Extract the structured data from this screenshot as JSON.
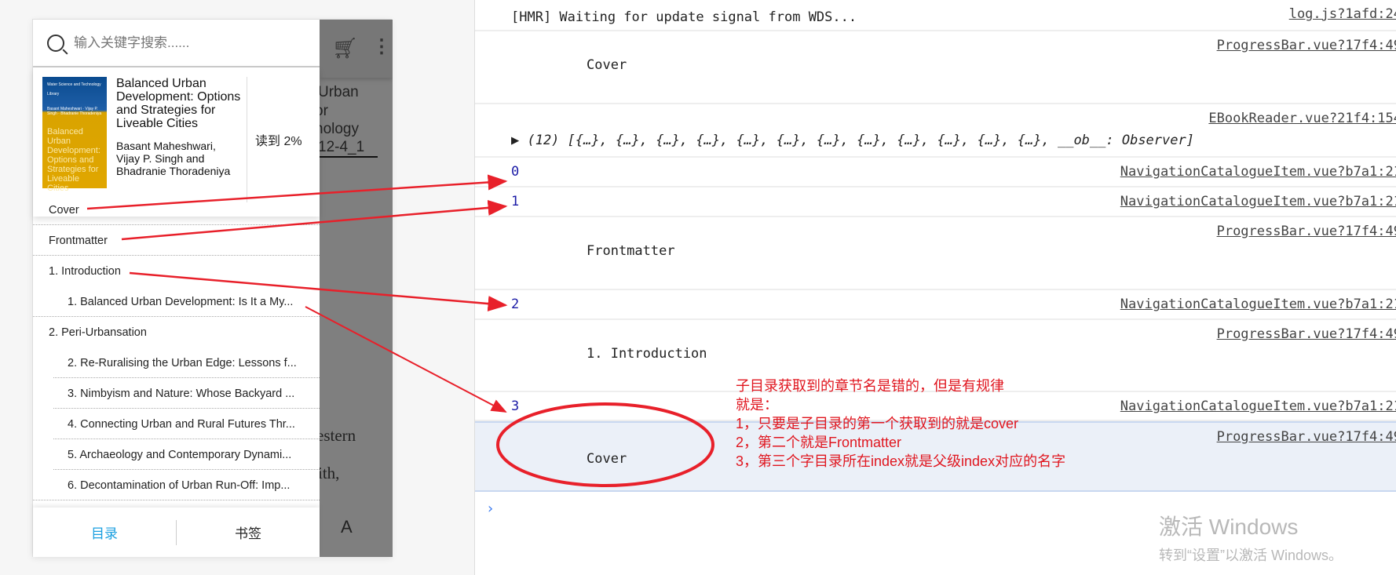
{
  "search": {
    "placeholder": "输入关键字搜索......"
  },
  "book": {
    "cover_series": "Water Science and Technology Library",
    "cover_authors": "Basant Maheshwari · Vijay P. Singh · Bhadranie Thoradeniya",
    "cover_title": "Balanced Urban Development: Options and Strategies for Liveable Cities",
    "title": "Balanced Urban Development: Options and Strategies for Liveable Cities",
    "authors": "Basant Maheshwari, Vijay P. Singh and Bhadranie Thoradeniya",
    "progress": "读到 2%"
  },
  "reader": {
    "lines": [
      "Urban",
      "or",
      "nology",
      "12-4_1"
    ],
    "body": [
      "estern",
      "ith,"
    ],
    "font_button": "A"
  },
  "catalogue": [
    {
      "label": "Cover",
      "level": 1
    },
    {
      "label": "Frontmatter",
      "level": 1
    },
    {
      "label": "1. Introduction",
      "level": 1
    },
    {
      "label": "1. Balanced Urban Development: Is It a My...",
      "level": 2
    },
    {
      "label": "2. Peri-Urbansation",
      "level": 1
    },
    {
      "label": "2. Re-Ruralising the Urban Edge: Lessons f...",
      "level": 2
    },
    {
      "label": "3. Nimbyism and Nature: Whose Backyard ...",
      "level": 2
    },
    {
      "label": "4. Connecting Urban and Rural Futures Thr...",
      "level": 2
    },
    {
      "label": "5. Archaeology and Contemporary Dynami...",
      "level": 2
    },
    {
      "label": "6. Decontamination of Urban Run-Off: Imp...",
      "level": 2
    }
  ],
  "tabs": {
    "catalogue": "目录",
    "bookmark": "书签"
  },
  "console": {
    "rows": [
      {
        "msg": "[HMR] Waiting for update signal from WDS...",
        "src": "log.js?1afd:24"
      },
      {
        "msg": "Cover",
        "src": "ProgressBar.vue?17f4:49"
      },
      {
        "msg": "▶ (12) [{…}, {…}, {…}, {…}, {…}, {…}, {…}, {…}, {…}, {…}, {…}, {…}, __ob__: Observer]",
        "src": "EBookReader.vue?21f4:154"
      },
      {
        "msg": "0",
        "src": "NavigationCatalogueItem.vue?b7a1:21"
      },
      {
        "msg": "1",
        "src": "NavigationCatalogueItem.vue?b7a1:21"
      },
      {
        "msg": "Frontmatter",
        "src": "ProgressBar.vue?17f4:49"
      },
      {
        "msg": "2",
        "src": "NavigationCatalogueItem.vue?b7a1:21"
      },
      {
        "msg": "1. Introduction",
        "src": "ProgressBar.vue?17f4:49"
      },
      {
        "msg": "3",
        "src": "NavigationCatalogueItem.vue?b7a1:21"
      },
      {
        "msg": "Cover",
        "src": "ProgressBar.vue?17f4:49"
      }
    ],
    "prompt": "›"
  },
  "annotation": {
    "lines": [
      "子目录获取到的章节名是错的，但是有规律",
      "就是：",
      "1，只要是子目录的第一个获取到的就是cover",
      "2，第二个就是Frontmatter",
      "3，第三个字目录所在index就是父级index对应的名字"
    ],
    "color": "#e0161f"
  },
  "watermark": {
    "line1": "激活 Windows",
    "line2": "转到“设置”以激活 Windows。"
  }
}
